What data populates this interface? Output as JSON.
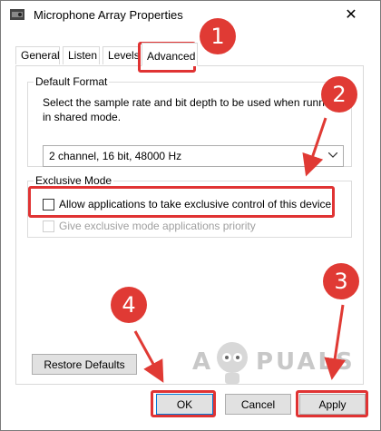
{
  "window": {
    "title": "Microphone Array Properties",
    "close_glyph": "✕"
  },
  "tabs": [
    {
      "label": "General"
    },
    {
      "label": "Listen"
    },
    {
      "label": "Levels"
    },
    {
      "label": "Advanced",
      "selected": true
    }
  ],
  "default_format": {
    "legend": "Default Format",
    "description_line1": "Select the sample rate and bit depth to be used when runnin",
    "description_line2": "in shared mode.",
    "selected_value": "2 channel, 16 bit, 48000 Hz"
  },
  "exclusive_mode": {
    "legend": "Exclusive Mode",
    "allow_label": "Allow applications to take exclusive control of this device",
    "allow_checked": false,
    "priority_label": "Give exclusive mode applications priority",
    "priority_checked": false,
    "priority_enabled": false
  },
  "buttons": {
    "restore": "Restore Defaults",
    "ok": "OK",
    "cancel": "Cancel",
    "apply": "Apply"
  },
  "annotations": {
    "badge1": "1",
    "badge2": "2",
    "badge3": "3",
    "badge4": "4",
    "accent": "#e03a34"
  },
  "watermark": {
    "left": "A",
    "right": "PUALS"
  }
}
